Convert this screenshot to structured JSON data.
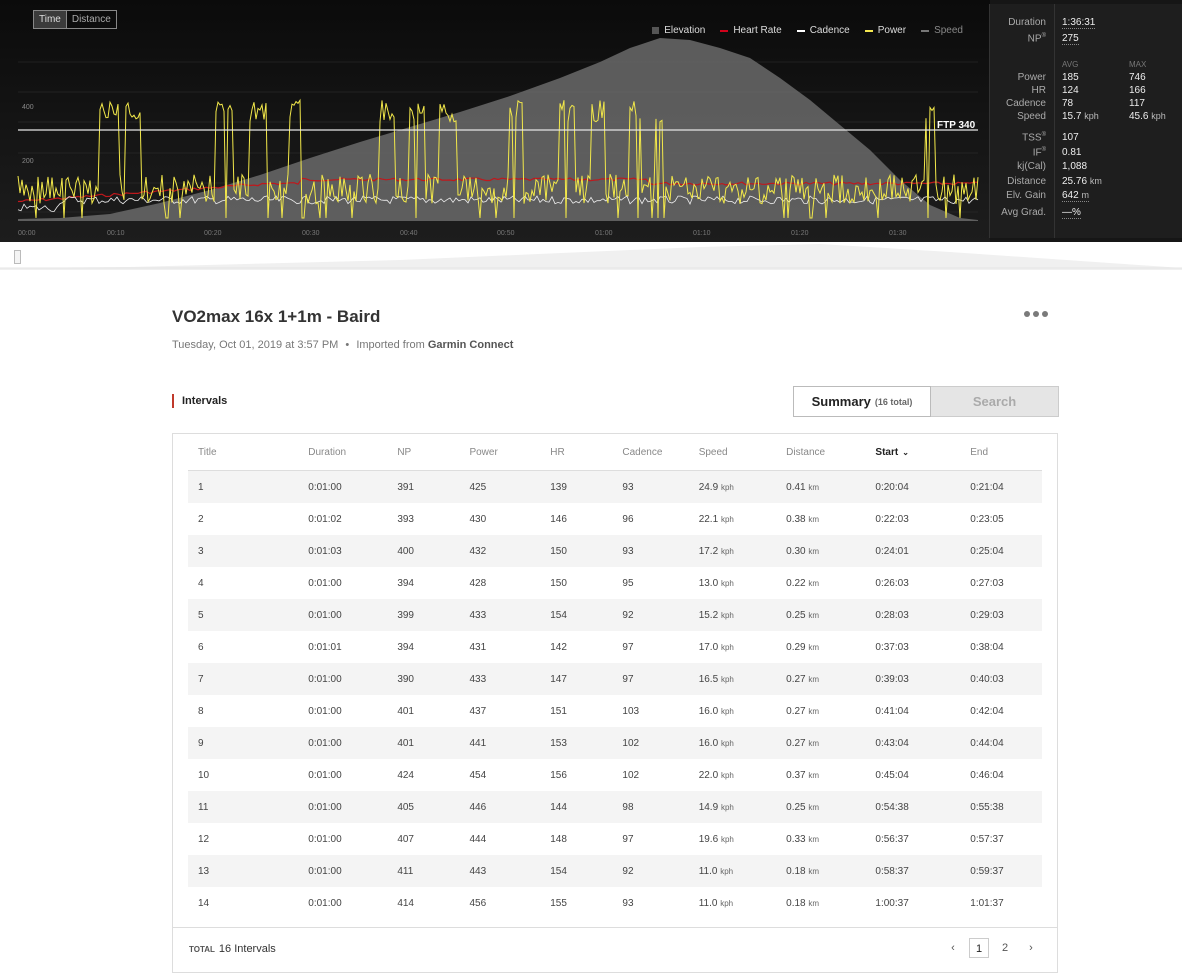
{
  "toolbar": {
    "time_label": "Time",
    "distance_label": "Distance"
  },
  "legend": [
    {
      "label": "Elevation",
      "color": "#555555"
    },
    {
      "label": "Heart Rate",
      "color": "#d0021b"
    },
    {
      "label": "Cadence",
      "color": "#ffffff"
    },
    {
      "label": "Power",
      "color": "#f5e850"
    },
    {
      "label": "Speed",
      "color": "#777777"
    }
  ],
  "chart": {
    "x_ticks": [
      "00:00",
      "00:10",
      "00:20",
      "00:30",
      "00:40",
      "00:50",
      "01:00",
      "01:10",
      "01:20",
      "01:30"
    ],
    "y_ticks": [
      "400",
      "200"
    ],
    "ftp_label": "FTP 340"
  },
  "chart_data": {
    "type": "line",
    "series": [
      {
        "name": "Elevation"
      },
      {
        "name": "Heart Rate"
      },
      {
        "name": "Cadence"
      },
      {
        "name": "Power"
      },
      {
        "name": "Speed"
      }
    ],
    "ftp": 340
  },
  "stats": {
    "duration_label": "Duration",
    "duration_value": "1:36:31",
    "np_label": "NP",
    "np_value": "275",
    "avg_head": "AVG",
    "max_head": "MAX",
    "rows": [
      {
        "label": "Power",
        "avg": "185",
        "max": "746",
        "avg_unit": "",
        "max_unit": ""
      },
      {
        "label": "HR",
        "avg": "124",
        "max": "166",
        "avg_unit": "",
        "max_unit": ""
      },
      {
        "label": "Cadence",
        "avg": "78",
        "max": "117",
        "avg_unit": "",
        "max_unit": ""
      },
      {
        "label": "Speed",
        "avg": "15.7",
        "max": "45.6",
        "avg_unit": "kph",
        "max_unit": "kph"
      }
    ],
    "tss_label": "TSS",
    "tss_value": "107",
    "if_label": "IF",
    "if_value": "0.81",
    "kj_label": "kj(Cal)",
    "kj_value": "1,088",
    "distance_label": "Distance",
    "distance_value": "25.76",
    "distance_unit": "km",
    "elv_label": "Elv. Gain",
    "elv_value": "642",
    "elv_unit": "m",
    "grad_label": "Avg Grad.",
    "grad_value": "—%"
  },
  "workout": {
    "title": "VO2max 16x 1+1m - Baird",
    "date": "Tuesday, Oct 01, 2019 at 3:57 PM",
    "imported_prefix": "Imported from",
    "imported_source": "Garmin Connect"
  },
  "intervals": {
    "heading": "Intervals",
    "summary_tab": "Summary",
    "summary_count": "(16 total)",
    "search_tab": "Search",
    "columns": [
      "Title",
      "Duration",
      "NP",
      "Power",
      "HR",
      "Cadence",
      "Speed",
      "Distance",
      "Start",
      "End"
    ],
    "rows": [
      [
        "1",
        "0:01:00",
        "391",
        "425",
        "139",
        "93",
        "24.9",
        "0.41",
        "0:20:04",
        "0:21:04"
      ],
      [
        "2",
        "0:01:02",
        "393",
        "430",
        "146",
        "96",
        "22.1",
        "0.38",
        "0:22:03",
        "0:23:05"
      ],
      [
        "3",
        "0:01:03",
        "400",
        "432",
        "150",
        "93",
        "17.2",
        "0.30",
        "0:24:01",
        "0:25:04"
      ],
      [
        "4",
        "0:01:00",
        "394",
        "428",
        "150",
        "95",
        "13.0",
        "0.22",
        "0:26:03",
        "0:27:03"
      ],
      [
        "5",
        "0:01:00",
        "399",
        "433",
        "154",
        "92",
        "15.2",
        "0.25",
        "0:28:03",
        "0:29:03"
      ],
      [
        "6",
        "0:01:01",
        "394",
        "431",
        "142",
        "97",
        "17.0",
        "0.29",
        "0:37:03",
        "0:38:04"
      ],
      [
        "7",
        "0:01:00",
        "390",
        "433",
        "147",
        "97",
        "16.5",
        "0.27",
        "0:39:03",
        "0:40:03"
      ],
      [
        "8",
        "0:01:00",
        "401",
        "437",
        "151",
        "103",
        "16.0",
        "0.27",
        "0:41:04",
        "0:42:04"
      ],
      [
        "9",
        "0:01:00",
        "401",
        "441",
        "153",
        "102",
        "16.0",
        "0.27",
        "0:43:04",
        "0:44:04"
      ],
      [
        "10",
        "0:01:00",
        "424",
        "454",
        "156",
        "102",
        "22.0",
        "0.37",
        "0:45:04",
        "0:46:04"
      ],
      [
        "11",
        "0:01:00",
        "405",
        "446",
        "144",
        "98",
        "14.9",
        "0.25",
        "0:54:38",
        "0:55:38"
      ],
      [
        "12",
        "0:01:00",
        "407",
        "444",
        "148",
        "97",
        "19.6",
        "0.33",
        "0:56:37",
        "0:57:37"
      ],
      [
        "13",
        "0:01:00",
        "411",
        "443",
        "154",
        "92",
        "11.0",
        "0.18",
        "0:58:37",
        "0:59:37"
      ],
      [
        "14",
        "0:01:00",
        "414",
        "456",
        "155",
        "93",
        "11.0",
        "0.18",
        "1:00:37",
        "1:01:37"
      ]
    ],
    "speed_unit": "kph",
    "distance_unit": "km",
    "total_label": "TOTAL",
    "total_value": "16 Intervals",
    "pages": [
      "1",
      "2"
    ],
    "current_page": "1"
  }
}
